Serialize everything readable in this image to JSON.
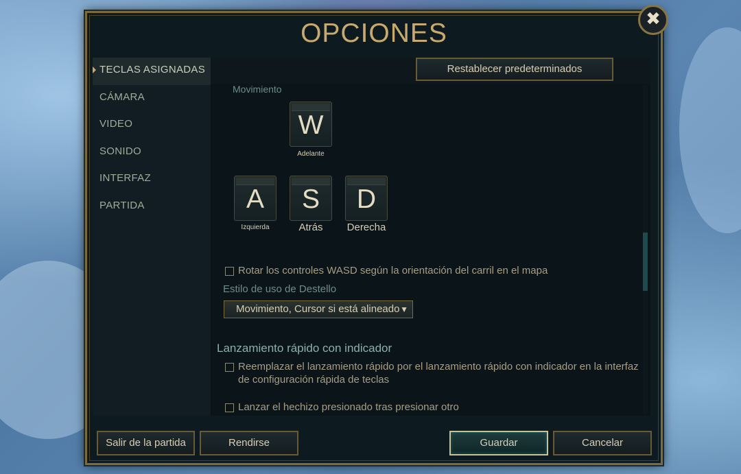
{
  "window": {
    "title": "OPCIONES",
    "close_glyph": "✖"
  },
  "sidebar": {
    "items": [
      {
        "label": "TECLAS ASIGNADAS",
        "active": true
      },
      {
        "label": "CÁMARA"
      },
      {
        "label": "VIDEO"
      },
      {
        "label": "SONIDO"
      },
      {
        "label": "INTERFAZ"
      },
      {
        "label": "PARTIDA"
      }
    ]
  },
  "content": {
    "reset_button": "Restablecer predeterminados",
    "movement_label": "Movimiento",
    "keys": {
      "w": {
        "letter": "W",
        "caption": "Adelante"
      },
      "a": {
        "letter": "A",
        "caption": "Izquierda"
      },
      "s": {
        "letter": "S",
        "caption": "Atrás"
      },
      "d": {
        "letter": "D",
        "caption": "Derecha"
      }
    },
    "rotate_wasd_checkbox": {
      "label": "Rotar los controles WASD según la orientación del carril en el mapa",
      "checked": false
    },
    "flash_style_label": "Estilo de uso de Destello",
    "flash_style_dropdown": {
      "value": "Movimiento, Cursor si está alineado",
      "arrow": "▼"
    },
    "quickcast_heading": "Lanzamiento rápido con indicador",
    "replace_quickcast_checkbox": {
      "label_line1": "Reemplazar el lanzamiento rápido por el lanzamiento rápido con indicador en la interfaz",
      "label_line2": "de configuración rápida de teclas",
      "checked": false
    },
    "cast_on_press_checkbox": {
      "label": "Lanzar el hechizo presionado tras presionar otro",
      "checked": false
    }
  },
  "footer": {
    "exit_game": "Salir de la partida",
    "surrender": "Rendirse",
    "save": "Guardar",
    "cancel": "Cancelar"
  },
  "colors": {
    "gold_border": "#7a6a3c",
    "title_gold": "#c8aa6e",
    "panel_bg": "#0a1419",
    "teal_accent": "#1c4d4e"
  }
}
